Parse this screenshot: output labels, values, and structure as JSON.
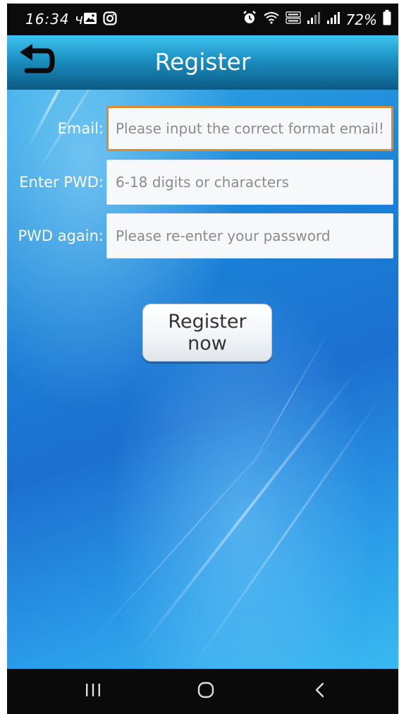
{
  "status_bar": {
    "time": "16:34 ч.",
    "battery_text": "72%",
    "icons": [
      "gallery-icon",
      "instagram-icon",
      "alarm-icon",
      "wifi-icon",
      "volte-icon",
      "signal-icon",
      "signal-icon",
      "battery-icon"
    ]
  },
  "header": {
    "title": "Register",
    "back_icon": "back-arrow-icon"
  },
  "form": {
    "email": {
      "label": "Email:",
      "placeholder": "Please input the correct format email!"
    },
    "password": {
      "label": "Enter PWD:",
      "placeholder": "6-18 digits or characters"
    },
    "password_again": {
      "label": "PWD again:",
      "placeholder": "Please re-enter your password"
    },
    "submit_label": "Register now"
  },
  "nav_bar": {
    "icons": [
      "recent-apps-icon",
      "home-icon",
      "back-icon"
    ]
  },
  "colors": {
    "header_top": "#3ec4ee",
    "header_bottom": "#0c5b83",
    "background_blue": "#1a7fd6",
    "focus_border": "#e08a2a"
  }
}
